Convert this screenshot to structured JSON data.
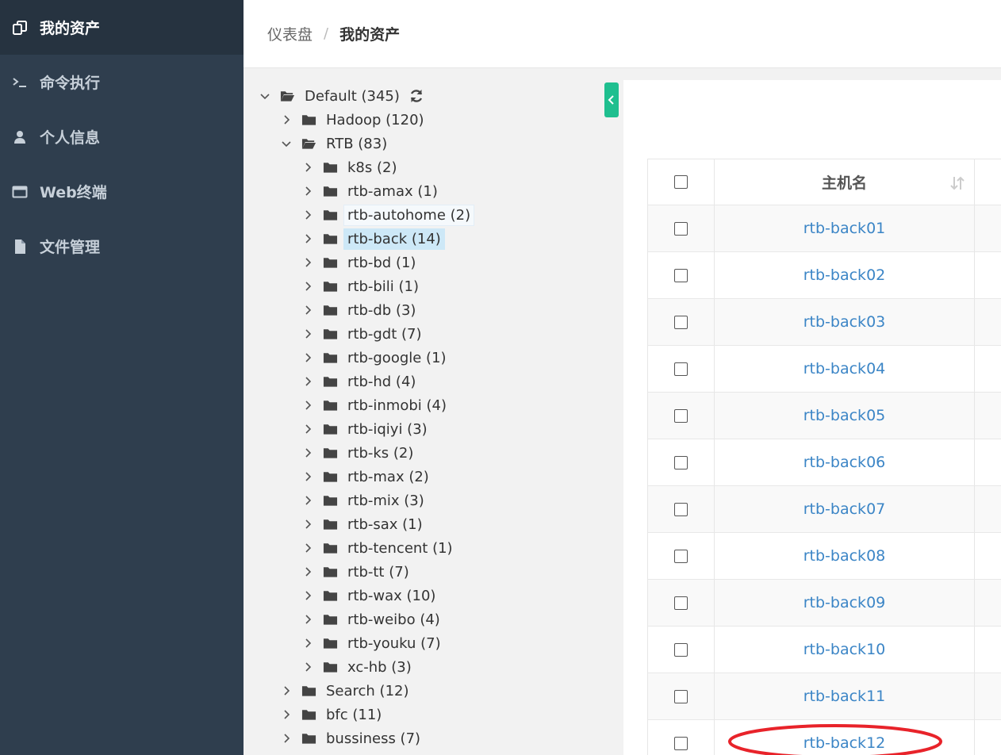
{
  "sidebar": {
    "items": [
      {
        "label": "我的资产",
        "icon": "assets-icon",
        "active": true
      },
      {
        "label": "命令执行",
        "icon": "terminal-icon",
        "active": false
      },
      {
        "label": "个人信息",
        "icon": "user-icon",
        "active": false
      },
      {
        "label": "Web终端",
        "icon": "window-icon",
        "active": false
      },
      {
        "label": "文件管理",
        "icon": "file-icon",
        "active": false
      }
    ]
  },
  "breadcrumb": {
    "parent": "仪表盘",
    "separator": "/",
    "current": "我的资产"
  },
  "tree": {
    "root": "Default (345)",
    "hadoop": "Hadoop (120)",
    "rtb": "RTB (83)",
    "rtb_children": [
      "k8s (2)",
      "rtb-amax (1)",
      "rtb-autohome (2)",
      "rtb-back (14)",
      "rtb-bd (1)",
      "rtb-bili (1)",
      "rtb-db (3)",
      "rtb-gdt (7)",
      "rtb-google (1)",
      "rtb-hd (4)",
      "rtb-inmobi (4)",
      "rtb-iqiyi (3)",
      "rtb-ks (2)",
      "rtb-max (2)",
      "rtb-mix (3)",
      "rtb-sax (1)",
      "rtb-tencent (1)",
      "rtb-tt (7)",
      "rtb-wax (10)",
      "rtb-weibo (4)",
      "rtb-youku (7)",
      "xc-hb (3)"
    ],
    "after": [
      "Search (12)",
      "bfc (11)",
      "bussiness (7)"
    ]
  },
  "table": {
    "header_hostname": "主机名",
    "rows": [
      "rtb-back01",
      "rtb-back02",
      "rtb-back03",
      "rtb-back04",
      "rtb-back05",
      "rtb-back06",
      "rtb-back07",
      "rtb-back08",
      "rtb-back09",
      "rtb-back10",
      "rtb-back11",
      "rtb-back12"
    ]
  },
  "colors": {
    "sidebar_bg": "#2f3e4e",
    "accent_toggle": "#1fbf8f",
    "link": "#3b85c6",
    "selection": "#cde8f7",
    "annotation": "#e8232a"
  }
}
